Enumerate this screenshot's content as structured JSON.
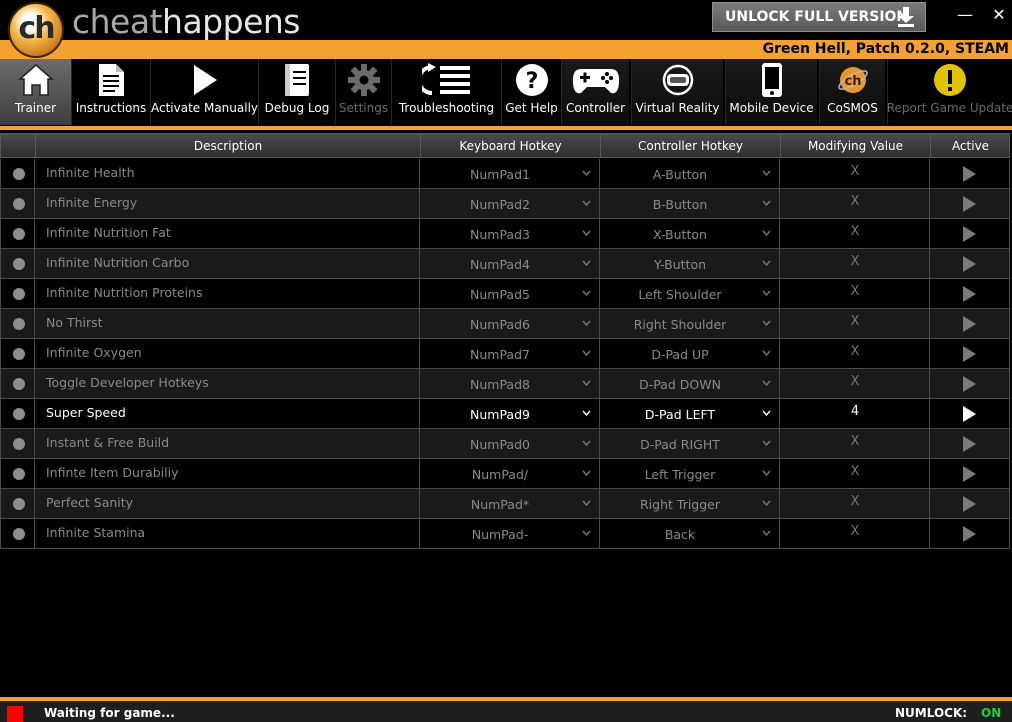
{
  "app": {
    "brand_word1": "cheat",
    "brand_word2": "happens",
    "logo_text": "ch",
    "unlock_label": "UNLOCK FULL VERSION",
    "game_title": "Green Hell, Patch 0.2.0, STEAM",
    "minimize_glyph": "—",
    "close_glyph": "✕"
  },
  "colors": {
    "accent": "#f3a22f",
    "status_waiting": "#ff0000",
    "numlock_on": "#27c93f"
  },
  "toolbar": [
    {
      "label": "Trainer",
      "icon": "home-icon",
      "active": true
    },
    {
      "label": "Instructions",
      "icon": "document-icon"
    },
    {
      "label": "Activate Manually",
      "icon": "play-icon"
    },
    {
      "label": "Debug Log",
      "icon": "notebook-icon"
    },
    {
      "label": "Settings",
      "icon": "gear-icon",
      "disabled": true
    },
    {
      "label": "Troubleshooting",
      "icon": "list-icon"
    },
    {
      "label": "Get Help",
      "icon": "help-icon"
    },
    {
      "label": "Controller",
      "icon": "gamepad-icon"
    },
    {
      "label": "Virtual Reality",
      "icon": "vr-headset-icon"
    },
    {
      "label": "Mobile Device",
      "icon": "phone-icon"
    },
    {
      "label": "CoSMOS",
      "icon": "cosmos-icon"
    },
    {
      "label": "Report Game Update",
      "icon": "warning-icon",
      "disabled": true
    }
  ],
  "table": {
    "headers": [
      "Description",
      "Keyboard Hotkey",
      "Controller Hotkey",
      "Modifying Value",
      "Active"
    ],
    "rows": [
      {
        "desc": "Infinite Health",
        "kb": "NumPad1",
        "ctl": "A-Button",
        "mod": "X"
      },
      {
        "desc": "Infinite Energy",
        "kb": "NumPad2",
        "ctl": "B-Button",
        "mod": "X"
      },
      {
        "desc": "Infinite Nutrition Fat",
        "kb": "NumPad3",
        "ctl": "X-Button",
        "mod": "X"
      },
      {
        "desc": "Infinite Nutrition Carbo",
        "kb": "NumPad4",
        "ctl": "Y-Button",
        "mod": "X"
      },
      {
        "desc": "Infinite Nutrition Proteins",
        "kb": "NumPad5",
        "ctl": "Left Shoulder",
        "mod": "X"
      },
      {
        "desc": "No Thirst",
        "kb": "NumPad6",
        "ctl": "Right Shoulder",
        "mod": "X"
      },
      {
        "desc": "Infinite Oxygen",
        "kb": "NumPad7",
        "ctl": "D-Pad UP",
        "mod": "X"
      },
      {
        "desc": "Toggle Developer Hotkeys",
        "kb": "NumPad8",
        "ctl": "D-Pad DOWN",
        "mod": "X"
      },
      {
        "desc": "Super Speed",
        "kb": "NumPad9",
        "ctl": "D-Pad LEFT",
        "mod": "4",
        "enabled": true
      },
      {
        "desc": "Instant & Free Build",
        "kb": "NumPad0",
        "ctl": "D-Pad RIGHT",
        "mod": "X"
      },
      {
        "desc": "Infinte Item Durabiliy",
        "kb": "NumPad/",
        "ctl": "Left Trigger",
        "mod": "X"
      },
      {
        "desc": "Perfect Sanity",
        "kb": "NumPad*",
        "ctl": "Right Trigger",
        "mod": "X"
      },
      {
        "desc": "Infinite Stamina",
        "kb": "NumPad-",
        "ctl": "Back",
        "mod": "X"
      }
    ]
  },
  "status": {
    "text": "Waiting for game...",
    "numlock_label": "NUMLOCK:",
    "numlock_value": "ON"
  }
}
